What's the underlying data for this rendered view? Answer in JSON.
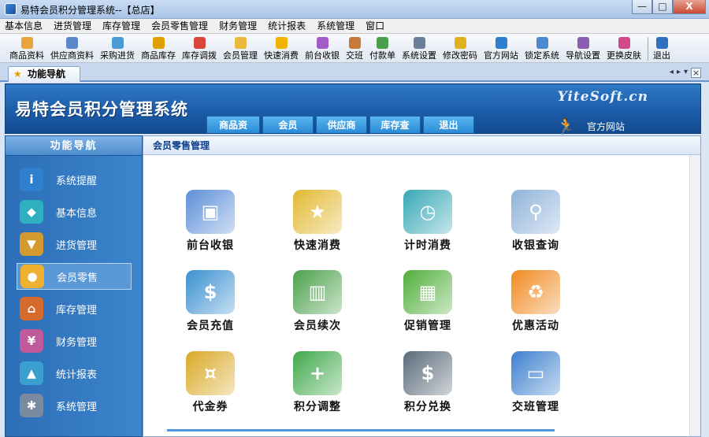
{
  "window": {
    "title": "易特会员积分管理系统--【总店】",
    "controls": {
      "minimize": "—",
      "maximize": "□",
      "close": "X"
    }
  },
  "menu": [
    "基本信息",
    "进货管理",
    "库存管理",
    "会员零售管理",
    "财务管理",
    "统计报表",
    "系统管理",
    "窗口"
  ],
  "toolbar": [
    {
      "label": "商品资料",
      "icon": "box-icon",
      "color": "#e8a33a"
    },
    {
      "label": "供应商资料",
      "icon": "people-icon",
      "color": "#5a88c9"
    },
    {
      "label": "采购进货",
      "icon": "truck-icon",
      "color": "#4a9bd6"
    },
    {
      "label": "商品库存",
      "icon": "stock-icon",
      "color": "#e0a000"
    },
    {
      "label": "库存调拨",
      "icon": "transfer-icon",
      "color": "#d9463b"
    },
    {
      "label": "会员管理",
      "icon": "member-icon",
      "color": "#e8b93a"
    },
    {
      "label": "快速消费",
      "icon": "coin-icon",
      "color": "#f0b400"
    },
    {
      "label": "前台收银",
      "icon": "cashier-icon",
      "color": "#a35cc7"
    },
    {
      "label": "交班",
      "icon": "shift-icon",
      "color": "#c97a3a"
    },
    {
      "label": "付款单",
      "icon": "bill-icon",
      "color": "#4aa04a"
    },
    {
      "label": "系统设置",
      "icon": "settings-icon",
      "color": "#6a7f98"
    },
    {
      "label": "修改密码",
      "icon": "key-icon",
      "color": "#e0b020"
    },
    {
      "label": "官方网站",
      "icon": "ie-icon",
      "color": "#2f7fd0"
    },
    {
      "label": "锁定系统",
      "icon": "lock-icon",
      "color": "#4c88d0"
    },
    {
      "label": "导航设置",
      "icon": "nav-icon",
      "color": "#8a5fb0"
    },
    {
      "label": "更换皮肤",
      "icon": "skin-icon",
      "color": "#d04a8a"
    },
    {
      "label": "退出",
      "icon": "exit-icon",
      "color": "#2f6fbf"
    }
  ],
  "tab": {
    "label": "功能导航",
    "icon": "star-icon"
  },
  "banner": {
    "system_name": "易特会员积分管理系统",
    "site": "YiteSoft.cn",
    "official_link": "官方网站",
    "nav_tabs": [
      "商品资料",
      "会员",
      "供应商",
      "库存查询",
      "退出"
    ]
  },
  "sidebar": {
    "title": "功能导航",
    "items": [
      {
        "label": "系统提醒",
        "icon": "info-icon",
        "color": "#2f7fcf",
        "glyph": "i"
      },
      {
        "label": "基本信息",
        "icon": "cubes-icon",
        "color": "#2fb0c0",
        "glyph": "◆"
      },
      {
        "label": "进货管理",
        "icon": "cart-icon",
        "color": "#d59a2e",
        "glyph": "▼"
      },
      {
        "label": "会员零售",
        "icon": "chat-icon",
        "color": "#f0b030",
        "glyph": "●"
      },
      {
        "label": "库存管理",
        "icon": "house-icon",
        "color": "#d56a2a",
        "glyph": "⌂"
      },
      {
        "label": "财务管理",
        "icon": "finance-icon",
        "color": "#c05a9a",
        "glyph": "¥"
      },
      {
        "label": "统计报表",
        "icon": "chart-icon",
        "color": "#3aa0d0",
        "glyph": "▲"
      },
      {
        "label": "系统管理",
        "icon": "gears-icon",
        "color": "#7a8aa0",
        "glyph": "✱"
      }
    ],
    "active_index": 3
  },
  "main": {
    "breadcrumb": "会员零售管理",
    "functions": [
      {
        "label": "前台收银",
        "icon": "pos-terminal-icon",
        "color": "#5b8ed8",
        "glyph": "▣"
      },
      {
        "label": "快速消费",
        "icon": "bee-mascot-icon",
        "color": "#e2b830",
        "glyph": "★"
      },
      {
        "label": "计时消费",
        "icon": "clock-icon",
        "color": "#36a8b6",
        "glyph": "◷"
      },
      {
        "label": "收银查询",
        "icon": "magnifier-icon",
        "color": "#8eb2da",
        "glyph": "⚲"
      },
      {
        "label": "会员充值",
        "icon": "card-dollar-icon",
        "color": "#3a8fd0",
        "glyph": "$"
      },
      {
        "label": "会员续次",
        "icon": "money-chart-icon",
        "color": "#4aa04a",
        "glyph": "▥"
      },
      {
        "label": "促销管理",
        "icon": "apps-grid-icon",
        "color": "#4fae3a",
        "glyph": "▦"
      },
      {
        "label": "优惠活动",
        "icon": "recycle-box-icon",
        "color": "#f08a20",
        "glyph": "♻"
      },
      {
        "label": "代金券",
        "icon": "banknotes-icon",
        "color": "#d9a825",
        "glyph": "¤"
      },
      {
        "label": "积分调整",
        "icon": "users-add-icon",
        "color": "#3fa84a",
        "glyph": "+"
      },
      {
        "label": "积分兑换",
        "icon": "businessman-icon",
        "color": "#5a6a7a",
        "glyph": "$"
      },
      {
        "label": "交班管理",
        "icon": "user-desk-icon",
        "color": "#3c7fcf",
        "glyph": "▭"
      }
    ]
  }
}
